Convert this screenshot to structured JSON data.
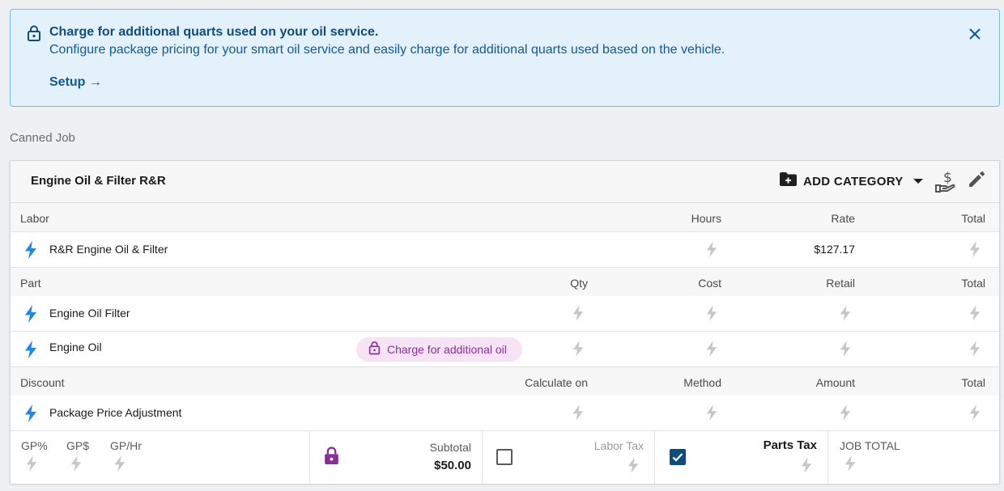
{
  "banner": {
    "title": "Charge for additional quarts used on your oil service.",
    "description": "Configure package pricing for your smart oil service and easily charge for additional quarts used based on the vehicle.",
    "setup_label": "Setup →",
    "icons": [
      "lock-icon",
      "close-icon"
    ]
  },
  "section_label": "Canned Job",
  "job": {
    "title": "Engine Oil & Filter R&R",
    "add_category_label": "ADD CATEGORY",
    "labor": {
      "headers": [
        "Labor",
        "Hours",
        "Rate",
        "Total"
      ],
      "items": [
        {
          "name": "R&R Engine Oil & Filter",
          "rate": "$127.17"
        }
      ]
    },
    "parts": {
      "headers": [
        "Part",
        "Qty",
        "Cost",
        "Retail",
        "Total"
      ],
      "items": [
        {
          "name": "Engine Oil Filter"
        },
        {
          "name": "Engine Oil",
          "badge": "Charge for additional oil"
        }
      ]
    },
    "discount": {
      "headers": [
        "Discount",
        "Calculate on",
        "Method",
        "Amount",
        "Total"
      ],
      "items": [
        {
          "name": "Package Price Adjustment"
        }
      ]
    },
    "footer": {
      "gp_pct": "GP%",
      "gp_dollar": "GP$",
      "gp_hr": "GP/Hr",
      "subtotal_label": "Subtotal",
      "subtotal_value": "$50.00",
      "labor_tax_label": "Labor Tax",
      "labor_tax_checked": false,
      "parts_tax_label": "Parts Tax",
      "parts_tax_checked": true,
      "job_total_label": "JOB TOTAL"
    }
  },
  "colors": {
    "accent_blue": "#1e88e5",
    "banner_text": "#0f5a96",
    "pill_purple": "#8e2c9f",
    "checkbox_checked": "#0f4d7f"
  }
}
